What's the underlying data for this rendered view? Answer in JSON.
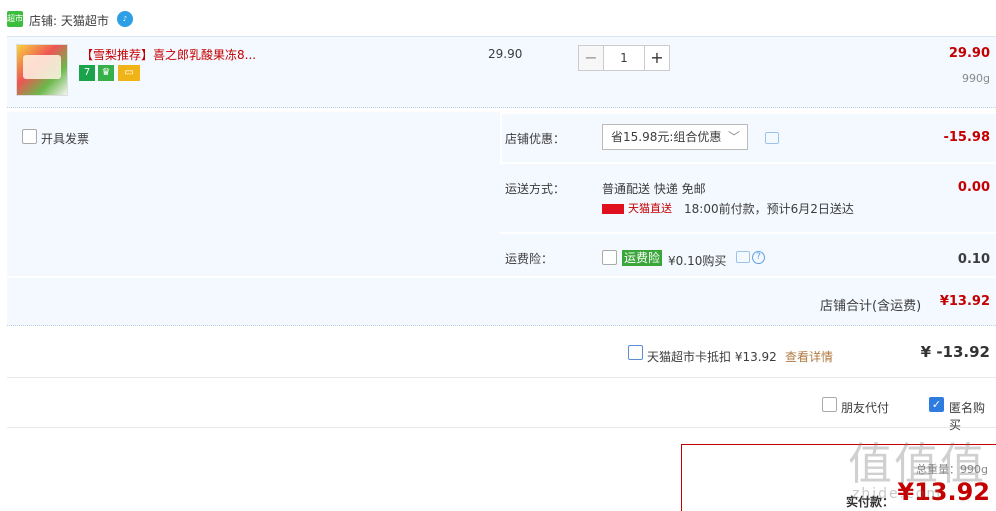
{
  "shop": {
    "logo_text": "超市",
    "name": "店铺: 天猫超市"
  },
  "item": {
    "title": "【雪梨推荐】喜之郎乳酸果冻8...",
    "badges": [
      "7",
      "♛",
      "▭"
    ],
    "unit_price": "29.90",
    "quantity": "1",
    "minus": "−",
    "plus": "+",
    "total": "29.90",
    "weight": "990g"
  },
  "options": {
    "invoice_label": "开具发票",
    "promo_label": "店铺优惠：",
    "promo_value": "省15.98元:组合优惠",
    "promo_amount": "-15.98",
    "ship_label": "运送方式：",
    "ship_text": "普通配送 快递 免邮",
    "tmall_direct": "天猫直送",
    "ship_time": "18:00前付款，预计6月2日送达",
    "ship_amount": "0.00",
    "insurance_label": "运费险：",
    "insurance_tag": "运费险",
    "insurance_price": "¥0.10购买",
    "insurance_amount": "0.10",
    "shop_total_label": "店铺合计(含运费)",
    "shop_total_amount": "¥13.92"
  },
  "card": {
    "text": "天猫超市卡抵扣 ¥13.92",
    "link": "查看详情",
    "amount": "¥ -13.92"
  },
  "friends": {
    "friend_label": "朋友代付",
    "anon_label": "匿名购买"
  },
  "pay": {
    "weight": "总重量：990g",
    "label": "实付款：",
    "amount": "¥13.92"
  },
  "watermark": {
    "main": "值值值",
    "sub": "zhide.com"
  }
}
